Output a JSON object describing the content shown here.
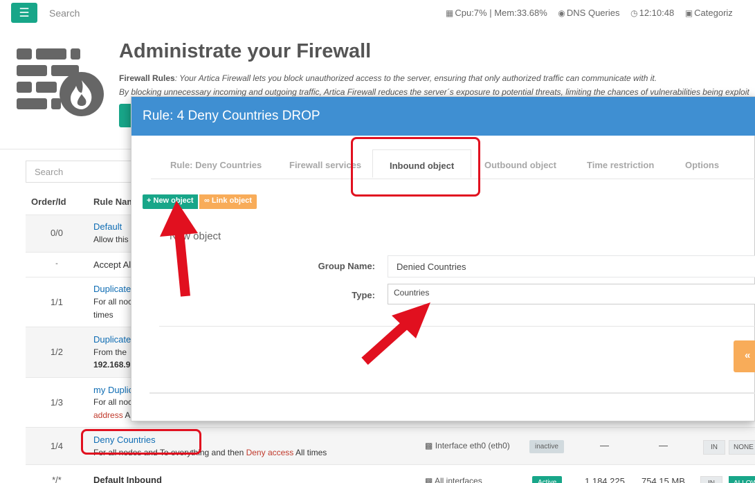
{
  "topbar": {
    "menu_icon": "hamburger-icon",
    "search_label": "Search",
    "cpu_mem": "Cpu:7% | Mem:33.68%",
    "dns": "DNS Queries",
    "time": "12:10:48",
    "category": "Categoriz"
  },
  "header": {
    "title": "Administrate your Firewall",
    "desc_bold": "Firewall Rules",
    "desc_line1": ": Your Artica Firewall lets you block unauthorized access to the server, ensuring that only authorized traffic can communicate with it.",
    "desc_line2": "By blocking unnecessary incoming and outgoing traffic, Artica Firewall reduces the server´s exposure to potential threats, limiting the chances of vulnerabilities being exploit"
  },
  "table": {
    "search_placeholder": "Search",
    "col_order": "Order/Id",
    "col_name": "Rule Nam",
    "rows": [
      {
        "order": "0/0",
        "name": "Default",
        "desc": "Allow this"
      },
      {
        "order": "-",
        "name": "Accept Al"
      },
      {
        "order": "1/1",
        "name": "Duplicate",
        "desc1": "For all noc",
        "desc2": "times"
      },
      {
        "order": "1/2",
        "name": "Duplicate",
        "desc1": "From the",
        "desc2": "192.168.9"
      },
      {
        "order": "1/3",
        "name": "my Duplic",
        "desc1": "For all noc",
        "desc2_red": "address",
        "desc2_rest": " A"
      },
      {
        "order": "1/4",
        "name": "Deny Countries",
        "desc_pre": "For all nodes and To everything and then ",
        "desc_red": "Deny access",
        "desc_post": " All times",
        "iface": "Interface eth0 (eth0)",
        "status": "inactive",
        "dash1": "—",
        "dash2": "—",
        "btn_in": "IN",
        "btn_none": "NONE"
      },
      {
        "order": "*/*",
        "name": "Default Inbound",
        "iface": "All interfaces",
        "status": "Active",
        "val1": "1,184,225",
        "val2": "754.15 MB",
        "btn_in": "IN",
        "btn_allow": "ALLOW"
      }
    ]
  },
  "modal": {
    "title": "Rule: 4 Deny Countries DROP",
    "tabs": [
      "Rule: Deny Countries",
      "Firewall services",
      "Inbound object",
      "Outbound object",
      "Time restriction",
      "Options"
    ],
    "active_tab": "Inbound object",
    "new_object_btn": "New object",
    "link_object_btn": "Link object",
    "section_title": "New object",
    "group_name_label": "Group Name:",
    "group_name_value": "Denied Countries",
    "type_label": "Type:",
    "type_value": "Countries",
    "back_btn": "«"
  },
  "colors": {
    "green": "#18a689",
    "blue_header": "#3f8fd2",
    "orange": "#f8ac59",
    "annotation_red": "#e1101f"
  }
}
